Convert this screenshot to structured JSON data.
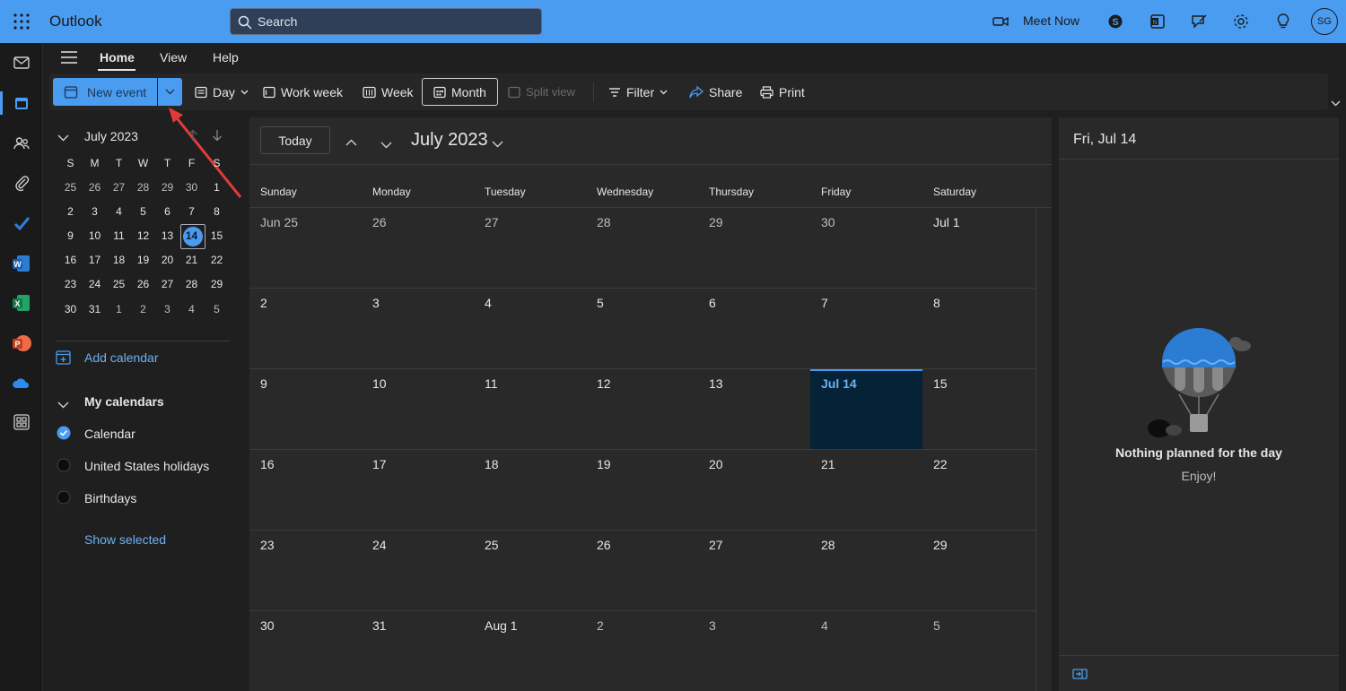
{
  "topbar": {
    "app_name": "Outlook",
    "search_placeholder": "Search",
    "meet_now": "Meet Now",
    "avatar_initials": "SG"
  },
  "tabs": [
    "Home",
    "View",
    "Help"
  ],
  "ribbon": {
    "new_event": "New event",
    "day": "Day",
    "work_week": "Work week",
    "week": "Week",
    "month": "Month",
    "split_view": "Split view",
    "filter": "Filter",
    "share": "Share",
    "print": "Print"
  },
  "mini_calendar": {
    "title": "July 2023",
    "dow": [
      "S",
      "M",
      "T",
      "W",
      "T",
      "F",
      "S"
    ],
    "weeks": [
      [
        "25",
        "26",
        "27",
        "28",
        "29",
        "30",
        "1"
      ],
      [
        "2",
        "3",
        "4",
        "5",
        "6",
        "7",
        "8"
      ],
      [
        "9",
        "10",
        "11",
        "12",
        "13",
        "14",
        "15"
      ],
      [
        "16",
        "17",
        "18",
        "19",
        "20",
        "21",
        "22"
      ],
      [
        "23",
        "24",
        "25",
        "26",
        "27",
        "28",
        "29"
      ],
      [
        "30",
        "31",
        "1",
        "2",
        "3",
        "4",
        "5"
      ]
    ],
    "selected": "14"
  },
  "sidebar": {
    "add_calendar": "Add calendar",
    "my_calendars": "My calendars",
    "calendars": [
      "Calendar",
      "United States holidays",
      "Birthdays"
    ],
    "show_selected": "Show selected"
  },
  "main": {
    "today_button": "Today",
    "month_title": "July 2023",
    "dow": [
      "Sunday",
      "Monday",
      "Tuesday",
      "Wednesday",
      "Thursday",
      "Friday",
      "Saturday"
    ],
    "weeks": [
      [
        "Jun 25",
        "26",
        "27",
        "28",
        "29",
        "30",
        "Jul 1"
      ],
      [
        "2",
        "3",
        "4",
        "5",
        "6",
        "7",
        "8"
      ],
      [
        "9",
        "10",
        "11",
        "12",
        "13",
        "Jul 14",
        "15"
      ],
      [
        "16",
        "17",
        "18",
        "19",
        "20",
        "21",
        "22"
      ],
      [
        "23",
        "24",
        "25",
        "26",
        "27",
        "28",
        "29"
      ],
      [
        "30",
        "31",
        "Aug 1",
        "2",
        "3",
        "4",
        "5"
      ]
    ]
  },
  "right_pane": {
    "title": "Fri, Jul 14",
    "empty_title": "Nothing planned for the day",
    "empty_subtitle": "Enjoy!"
  },
  "colors": {
    "accent": "#4a9cf0",
    "today_cell": "#062236",
    "annotation_arrow": "#e23a3a"
  }
}
